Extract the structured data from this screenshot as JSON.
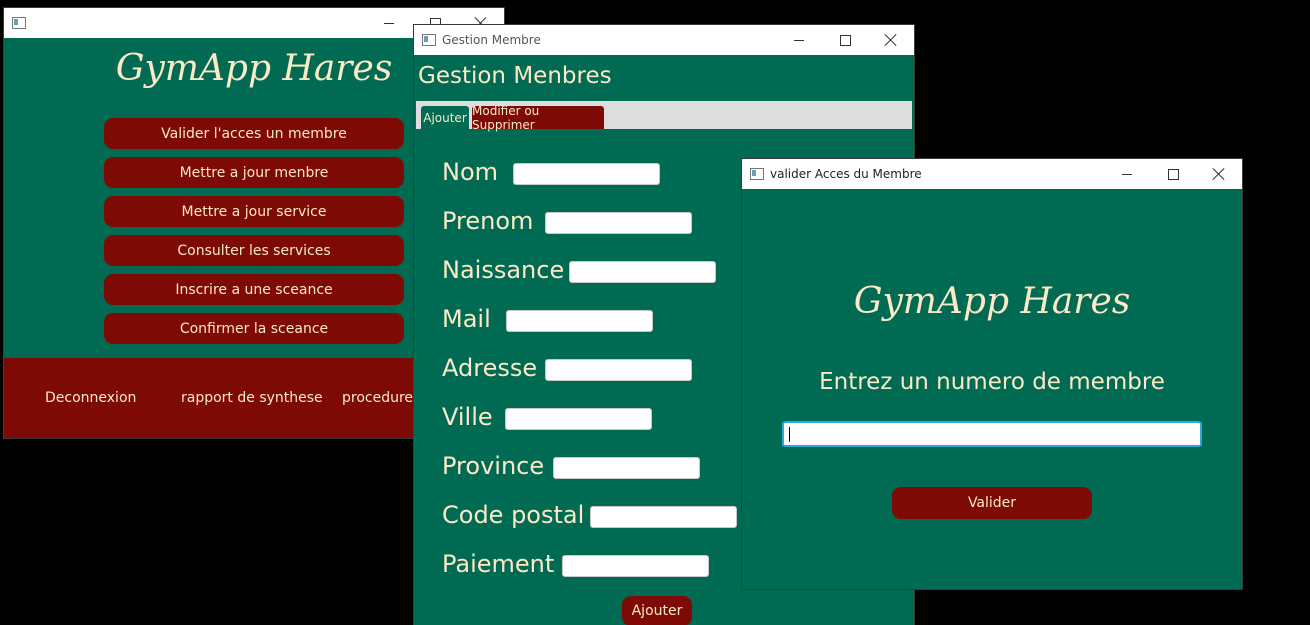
{
  "main_window": {
    "title": "",
    "app_title": "GymApp Hares",
    "menu_buttons": [
      "Valider l'acces  un membre",
      "Mettre a  jour menbre",
      "Mettre a jour service",
      "Consulter les services",
      "Inscrire  a une sceance",
      "Confirmer la sceance"
    ],
    "footer_links": [
      "Deconnexion",
      "rapport de synthese",
      "procedure"
    ]
  },
  "gestion_window": {
    "title": "Gestion Membre",
    "heading": "Gestion Menbres",
    "tabs": [
      "Ajouter",
      "Modifier ou Supprimer"
    ],
    "fields": [
      "Nom",
      "Prenom",
      "Naissance",
      "Mail",
      "Adresse",
      "Ville",
      "Province",
      "Code postal",
      "Paiement"
    ],
    "add_button": "Ajouter"
  },
  "valider_window": {
    "title": "valider Acces du Membre",
    "app_title": "GymApp Hares",
    "prompt": "Entrez un numero de membre",
    "input_value": "",
    "submit_button": "Valider"
  },
  "colors": {
    "window_bg": "#006b52",
    "accent_red": "#7d0a05",
    "text_cream": "#fbe9c7",
    "focus_border": "#2aa9d8"
  },
  "icons": [
    "app-icon",
    "minimize-icon",
    "maximize-icon",
    "close-icon"
  ]
}
